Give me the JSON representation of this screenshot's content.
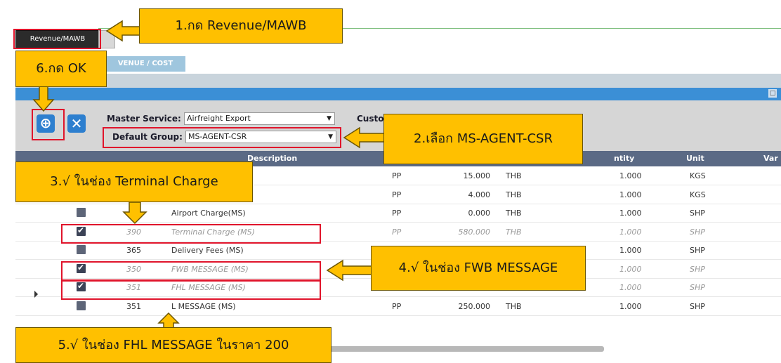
{
  "tabs": {
    "revenue_mawb": "Revenue/MAWB",
    "sub_tab": "VENUE / COST"
  },
  "form": {
    "master_service_label": "Master Service:",
    "master_service_value": "Airfreight Export",
    "default_group_label": "Default Group:",
    "default_group_value": "MS-AGENT-CSR",
    "customer_label": "Custo"
  },
  "grid": {
    "headers": {
      "description": "Description",
      "quantity": "ntity",
      "unit": "Unit",
      "var": "Var"
    },
    "rows": [
      {
        "code": "",
        "desc": "",
        "pp": "PP",
        "amount": "15.000",
        "cur": "THB",
        "qty": "1.000",
        "unit": "KGS",
        "checked": false,
        "muted": false
      },
      {
        "code": "",
        "desc": "",
        "pp": "PP",
        "amount": "4.000",
        "cur": "THB",
        "qty": "1.000",
        "unit": "KGS",
        "checked": false,
        "muted": false
      },
      {
        "code": "",
        "desc": "Airport Charge(MS)",
        "pp": "PP",
        "amount": "0.000",
        "cur": "THB",
        "qty": "1.000",
        "unit": "SHP",
        "checked": false,
        "muted": false
      },
      {
        "code": "390",
        "desc": "Terminal Charge (MS)",
        "pp": "PP",
        "amount": "580.000",
        "cur": "THB",
        "qty": "1.000",
        "unit": "SHP",
        "checked": true,
        "muted": true
      },
      {
        "code": "365",
        "desc": "Delivery Fees (MS)",
        "pp": "",
        "amount": "",
        "cur": "",
        "qty": "1.000",
        "unit": "SHP",
        "checked": false,
        "muted": false
      },
      {
        "code": "350",
        "desc": "FWB MESSAGE (MS)",
        "pp": "",
        "amount": "",
        "cur": "",
        "qty": "1.000",
        "unit": "SHP",
        "checked": true,
        "muted": true
      },
      {
        "code": "351",
        "desc": "FHL MESSAGE (MS)",
        "pp": "",
        "amount": "",
        "cur": "",
        "qty": "1.000",
        "unit": "SHP",
        "checked": true,
        "muted": true
      },
      {
        "code": "351",
        "desc": "L MESSAGE (MS)",
        "pp": "PP",
        "amount": "250.000",
        "cur": "THB",
        "qty": "1.000",
        "unit": "SHP",
        "checked": false,
        "muted": false
      }
    ]
  },
  "callouts": {
    "step1": "1.กด Revenue/MAWB",
    "step2": "2.เลือก MS-AGENT-CSR",
    "step3": "3.√ ในช่อง Terminal Charge",
    "step4": "4.√ ในช่อง FWB MESSAGE",
    "step5": "5.√ ในช่อง  FHL MESSAGE ในราคา 200",
    "step6": "6.กด OK"
  },
  "colors": {
    "callout": "#ffc000",
    "highlight": "#e0142b",
    "grid_header": "#5b6a85",
    "panel_bar": "#3b8fd6"
  },
  "icons": {
    "ok": "plus-circle-icon",
    "cancel": "close-icon"
  }
}
